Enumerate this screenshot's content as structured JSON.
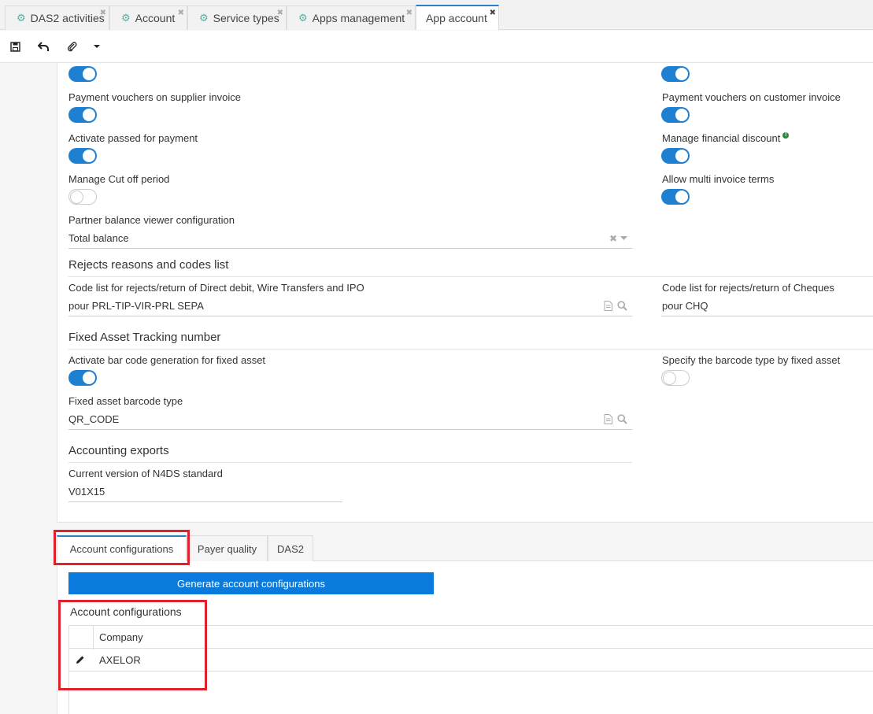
{
  "tabs": [
    {
      "label": "DAS2 activities",
      "icon": "gear-icon",
      "active": false
    },
    {
      "label": "Account",
      "icon": "gear-icon",
      "active": false
    },
    {
      "label": "Service types",
      "icon": "gear-icon",
      "active": false
    },
    {
      "label": "Apps management",
      "icon": "gear-icon",
      "active": false
    },
    {
      "label": "App account",
      "icon": "",
      "active": true
    }
  ],
  "toolbar": {
    "icons": [
      "save-icon",
      "undo-icon",
      "attachment-icon",
      "caret-down-icon"
    ]
  },
  "form": {
    "top_left_toggle": true,
    "top_right_toggle": true,
    "payment_vouchers_supplier": {
      "label": "Payment vouchers on supplier invoice",
      "value": true
    },
    "payment_vouchers_customer": {
      "label": "Payment vouchers on customer invoice",
      "value": true
    },
    "activate_passed": {
      "label": "Activate passed for payment",
      "value": true
    },
    "manage_financial_discount": {
      "label": "Manage financial discount",
      "value": true
    },
    "manage_cut_off": {
      "label": "Manage Cut off period",
      "value": false
    },
    "allow_multi_invoice_terms": {
      "label": "Allow multi invoice terms",
      "value": true
    },
    "partner_balance": {
      "label": "Partner balance viewer configuration",
      "value": "Total balance"
    },
    "rejects_section": "Rejects reasons and codes list",
    "code_list_direct_debit": {
      "label": "Code list for rejects/return of Direct debit, Wire Transfers and IPO",
      "value": "pour PRL-TIP-VIR-PRL SEPA"
    },
    "code_list_cheques": {
      "label": "Code list for rejects/return of Cheques",
      "value": "pour CHQ"
    },
    "fixed_asset_section": "Fixed Asset Tracking number",
    "activate_barcode": {
      "label": "Activate bar code generation for fixed asset",
      "value": true
    },
    "specify_barcode": {
      "label": "Specify the barcode type by fixed asset",
      "value": false
    },
    "fixed_asset_barcode_type": {
      "label": "Fixed asset barcode type",
      "value": "QR_CODE"
    },
    "accounting_exports_section": "Accounting exports",
    "n4ds_version": {
      "label": "Current version of N4DS standard",
      "value": "V01X15"
    }
  },
  "bottom_tabs": [
    {
      "label": "Account configurations",
      "active": true
    },
    {
      "label": "Payer quality",
      "active": false
    },
    {
      "label": "DAS2",
      "active": false
    }
  ],
  "generate_button": "Generate account configurations",
  "account_configurations": {
    "title": "Account configurations",
    "columns": [
      "Company"
    ],
    "rows": [
      {
        "company": "AXELOR"
      }
    ]
  },
  "colors": {
    "accent": "#1f7fd1",
    "highlight": "#e0202a"
  }
}
